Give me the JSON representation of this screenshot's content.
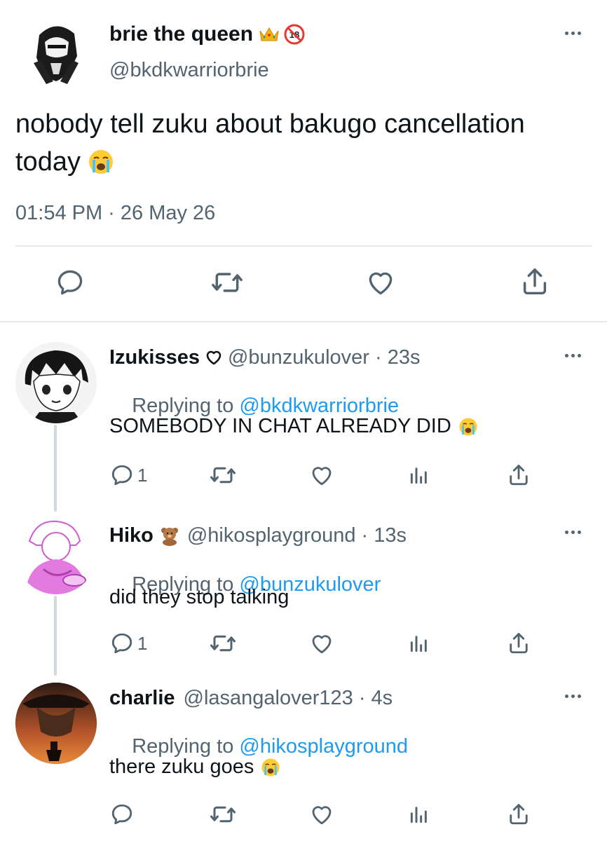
{
  "main_tweet": {
    "display_name": "brie the queen",
    "badges": [
      "crown-icon",
      "18-plus-icon"
    ],
    "handle": "@bkdkwarriorbrie",
    "text": "nobody tell zuku about bakugo cancellation\ntoday",
    "text_line1": "nobody tell zuku about bakugo cancellation",
    "text_line2": "today",
    "text_emoji": "loudly-crying-face",
    "timestamp": "01:54 PM · 26 May 26",
    "actions": [
      "reply-icon",
      "retweet-icon",
      "like-icon",
      "share-icon"
    ]
  },
  "replies": [
    {
      "display_name": "Izukisses",
      "name_badge": "heart-outline-icon",
      "handle": "@bunzukulover",
      "age": " · 23s",
      "replying_prefix": "Replying to ",
      "replying_to": "@bkdkwarriorbrie",
      "text": "SOMEBODY IN CHAT ALREADY DID",
      "text_emoji": "loudly-crying-face",
      "reply_count": "1"
    },
    {
      "display_name": "Hiko",
      "name_badge": "teddy-bear-icon",
      "handle": "@hikosplayground",
      "age": " · 13s",
      "replying_prefix": "Replying to ",
      "replying_to": "@bunzukulover",
      "text": "did they stop talking",
      "reply_count": "1"
    },
    {
      "display_name": "charlie",
      "handle": "@lasangalover123",
      "age": " · 4s",
      "replying_prefix": "Replying to ",
      "replying_to": "@hikosplayground",
      "text": "there zuku goes",
      "text_emoji": "loudly-crying-face",
      "reply_count": ""
    }
  ],
  "colors": {
    "text": "#0f1419",
    "secondary": "#536471",
    "link": "#1d9bf0",
    "divider": "#e6e9eb",
    "thread_line": "#cfd9de"
  }
}
